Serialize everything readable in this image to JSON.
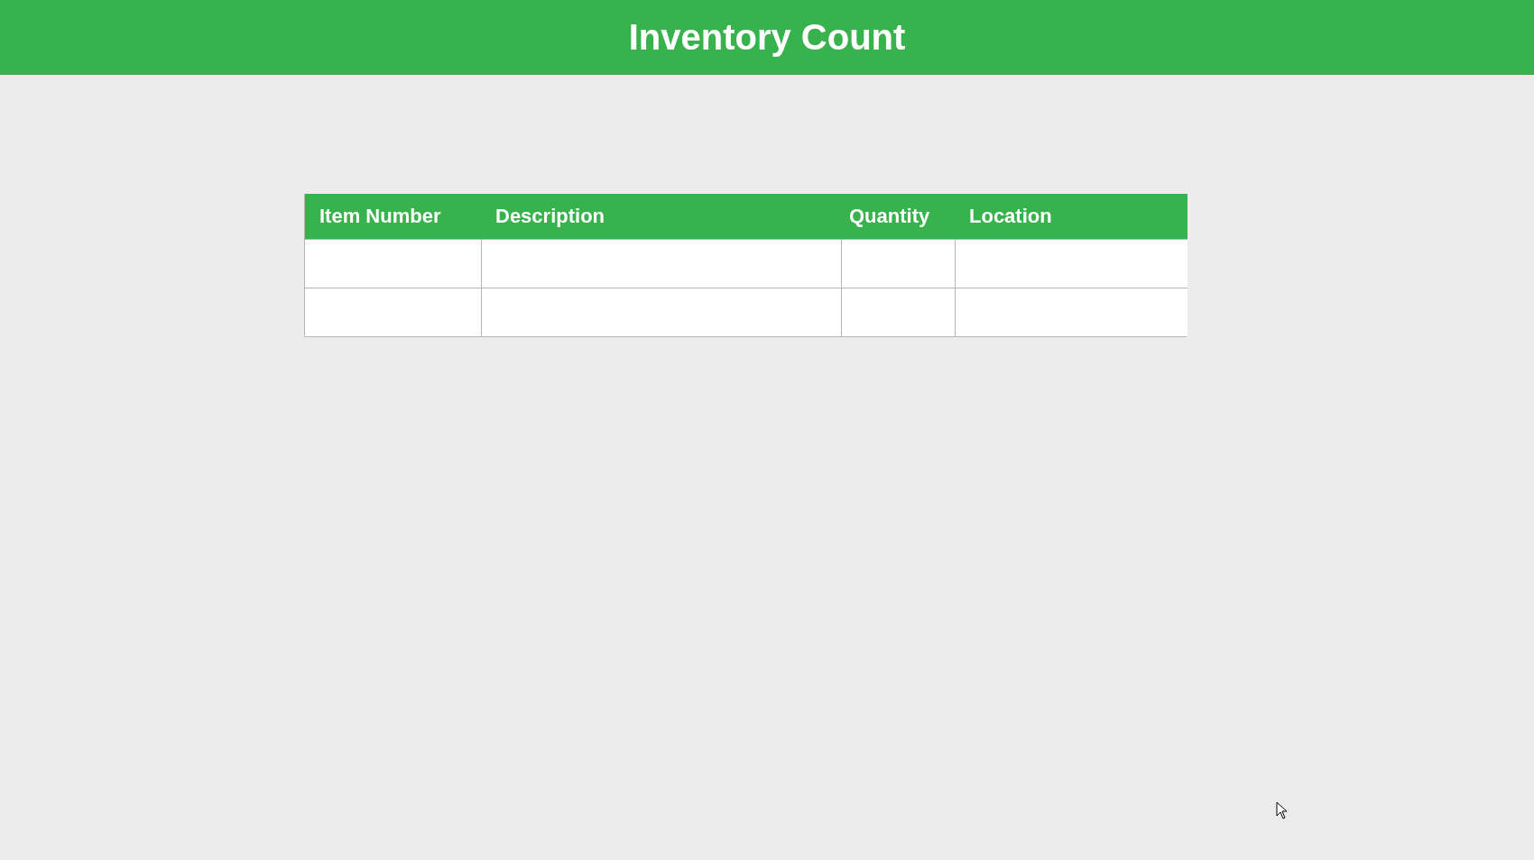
{
  "header": {
    "title": "Inventory Count"
  },
  "table": {
    "columns": [
      "Item Number",
      "Description",
      "Quantity",
      "Location"
    ],
    "rows": [
      {},
      {}
    ]
  }
}
